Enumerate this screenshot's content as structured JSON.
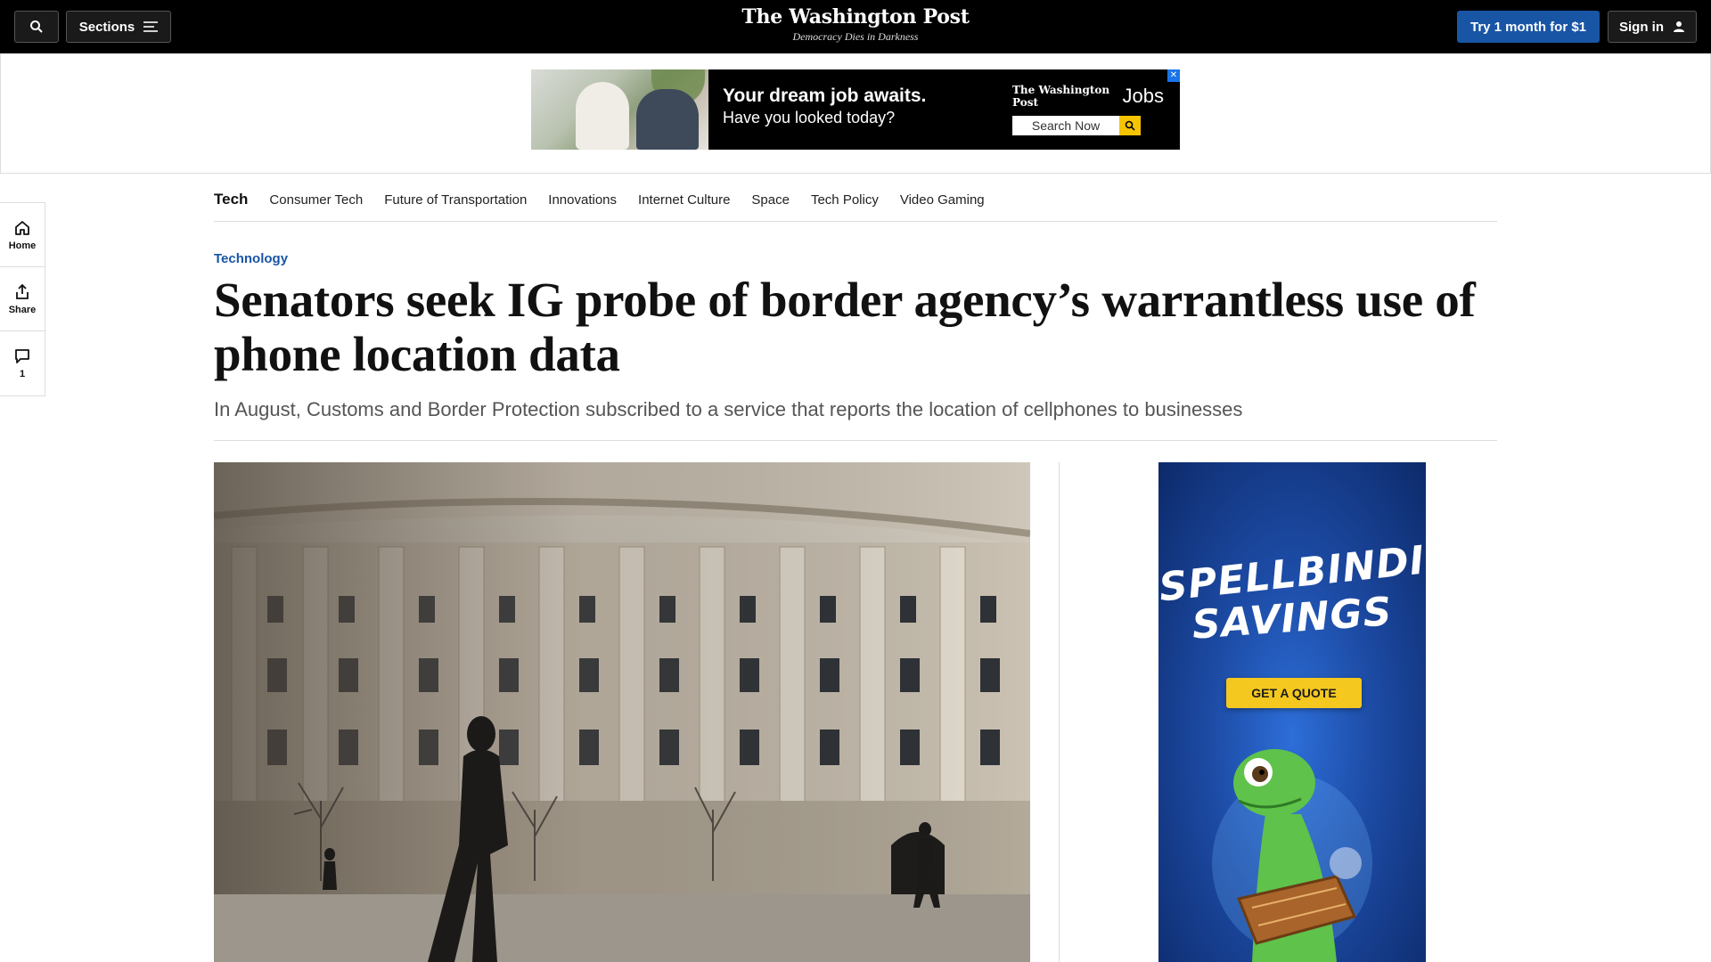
{
  "header": {
    "sections_label": "Sections",
    "logo": "The Washington Post",
    "tagline": "Democracy Dies in Darkness",
    "subscribe_label": "Try 1 month for $1",
    "signin_label": "Sign in"
  },
  "top_ad": {
    "headline": "Your dream job awaits.",
    "subline": "Have you looked today?",
    "brand": "The Washington Post",
    "product": "Jobs",
    "search_label": "Search Now"
  },
  "rail": {
    "home_label": "Home",
    "share_label": "Share",
    "comments_count": "1"
  },
  "section_nav": {
    "title": "Tech",
    "links": [
      "Consumer Tech",
      "Future of Transportation",
      "Innovations",
      "Internet Culture",
      "Space",
      "Tech Policy",
      "Video Gaming"
    ]
  },
  "article": {
    "kicker": "Technology",
    "headline": "Senators seek IG probe of border agency’s warrantless use of phone location data",
    "dek": "In August, Customs and Border Protection subscribed to a service that reports the location of cellphones to businesses"
  },
  "side_ad": {
    "line1": "SPELLBINDING",
    "line2": "SAVINGS",
    "cta": "GET A QUOTE"
  },
  "colors": {
    "accent_blue": "#1955a5",
    "topbar": "#000000"
  }
}
